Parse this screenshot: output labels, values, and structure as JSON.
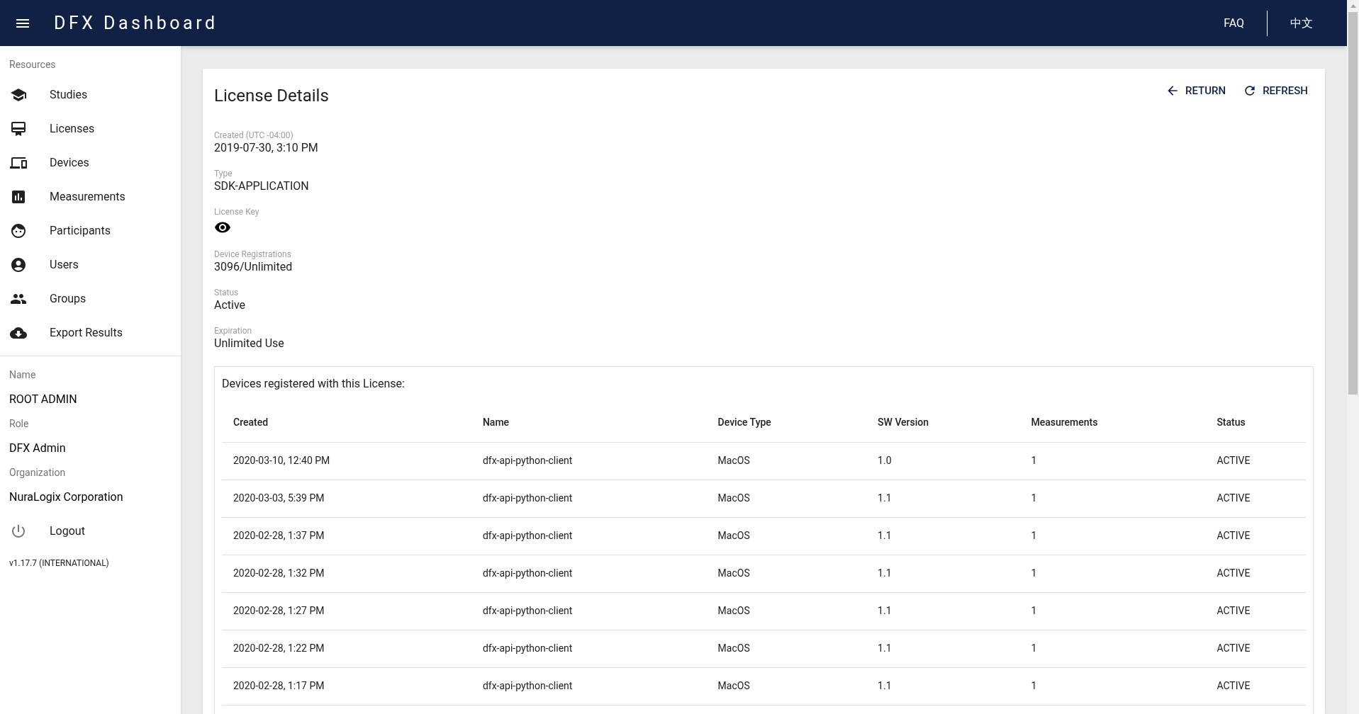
{
  "app_bar": {
    "title": "DFX Dashboard",
    "links": [
      "FAQ",
      "中文"
    ]
  },
  "sidebar": {
    "section_label": "Resources",
    "items": [
      {
        "label": "Studies",
        "kind": "studies"
      },
      {
        "label": "Licenses",
        "kind": "licenses"
      },
      {
        "label": "Devices",
        "kind": "devices"
      },
      {
        "label": "Measurements",
        "kind": "measurements"
      },
      {
        "label": "Participants",
        "kind": "participants"
      },
      {
        "label": "Users",
        "kind": "users"
      },
      {
        "label": "Groups",
        "kind": "groups"
      },
      {
        "label": "Export Results",
        "kind": "export"
      }
    ],
    "profile": [
      {
        "label": "Name",
        "value": "ROOT ADMIN"
      },
      {
        "label": "Role",
        "value": "DFX Admin"
      },
      {
        "label": "Organization",
        "value": "NuraLogix Corporation"
      }
    ],
    "logout": "Logout",
    "version": "v1.17.7 (INTERNATIONAL)"
  },
  "card": {
    "title": "License Details",
    "actions": [
      {
        "label": "RETURN",
        "kind": "return"
      },
      {
        "label": "REFRESH",
        "kind": "refresh"
      }
    ],
    "fields": [
      {
        "label": "Created (UTC -04:00)",
        "value": "2019-07-30, 3:10 PM",
        "kind": "text"
      },
      {
        "label": "Type",
        "value": "SDK-APPLICATION",
        "kind": "text"
      },
      {
        "label": "License Key",
        "kind": "hidden"
      },
      {
        "label": "Device Registrations",
        "value": "3096/Unlimited",
        "kind": "text"
      },
      {
        "label": "Status",
        "value": "Active",
        "kind": "text"
      },
      {
        "label": "Expiration",
        "value": "Unlimited Use",
        "kind": "text"
      }
    ],
    "devices": {
      "caption": "Devices registered with this License:",
      "columns": [
        "Created",
        "Name",
        "Device Type",
        "SW Version",
        "Measurements",
        "Status"
      ],
      "rows": [
        [
          "2020-03-10, 12:40 PM",
          "dfx-api-python-client",
          "MacOS",
          "1.0",
          "1",
          "ACTIVE"
        ],
        [
          "2020-03-03, 5:39 PM",
          "dfx-api-python-client",
          "MacOS",
          "1.1",
          "1",
          "ACTIVE"
        ],
        [
          "2020-02-28, 1:37 PM",
          "dfx-api-python-client",
          "MacOS",
          "1.1",
          "1",
          "ACTIVE"
        ],
        [
          "2020-02-28, 1:32 PM",
          "dfx-api-python-client",
          "MacOS",
          "1.1",
          "1",
          "ACTIVE"
        ],
        [
          "2020-02-28, 1:27 PM",
          "dfx-api-python-client",
          "MacOS",
          "1.1",
          "1",
          "ACTIVE"
        ],
        [
          "2020-02-28, 1:22 PM",
          "dfx-api-python-client",
          "MacOS",
          "1.1",
          "1",
          "ACTIVE"
        ],
        [
          "2020-02-28, 1:17 PM",
          "dfx-api-python-client",
          "MacOS",
          "1.1",
          "1",
          "ACTIVE"
        ]
      ]
    }
  }
}
